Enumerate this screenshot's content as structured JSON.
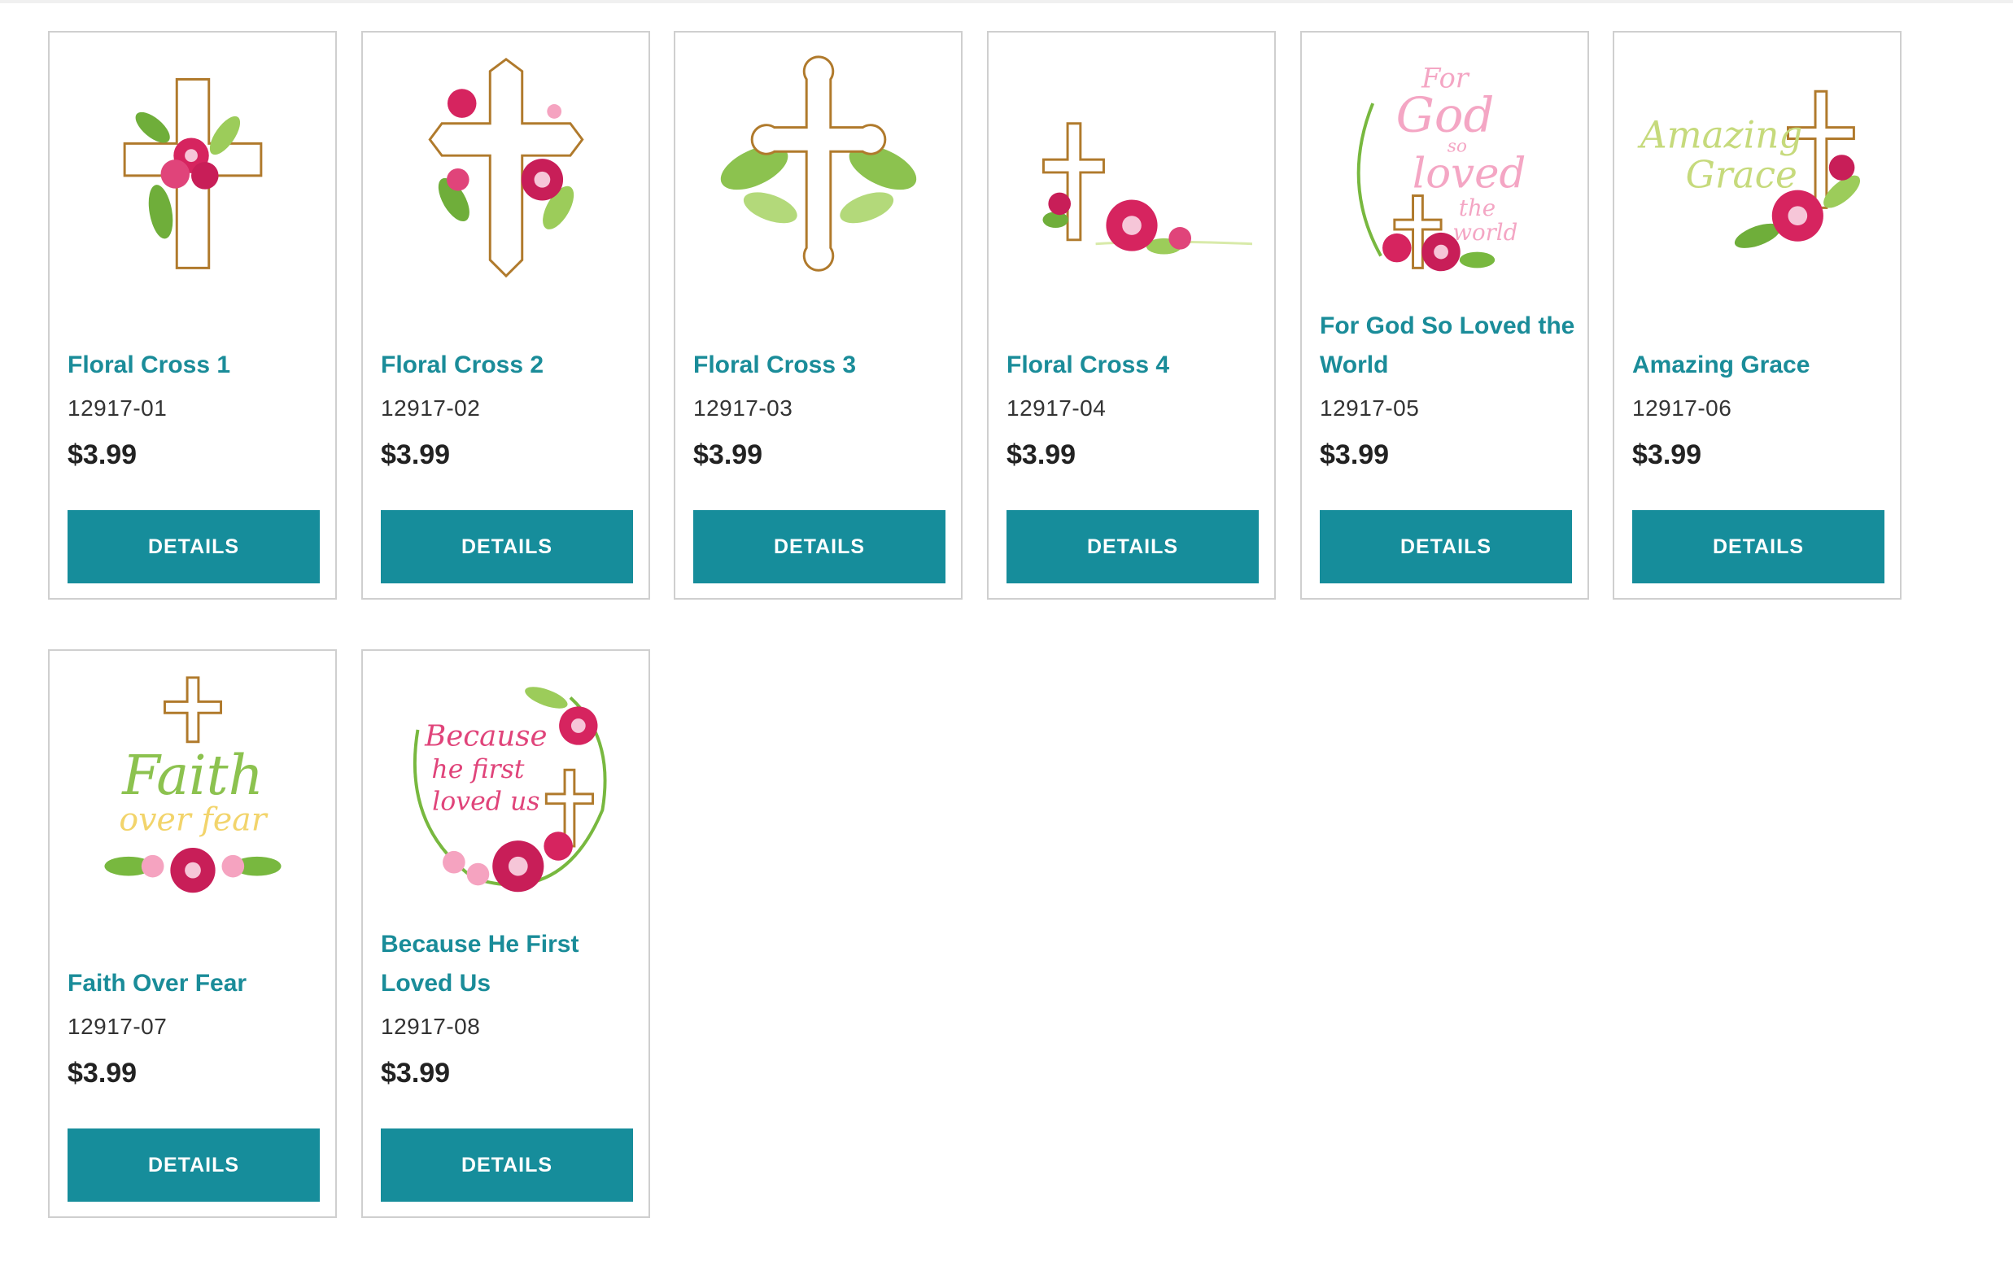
{
  "products": [
    {
      "title": "Floral Cross 1",
      "sku": "12917-01",
      "price": "$3.99",
      "button_label": "DETAILS",
      "icon": "floral-cross-icon"
    },
    {
      "title": "Floral Cross 2",
      "sku": "12917-02",
      "price": "$3.99",
      "button_label": "DETAILS",
      "icon": "floral-cross-icon"
    },
    {
      "title": "Floral Cross 3",
      "sku": "12917-03",
      "price": "$3.99",
      "button_label": "DETAILS",
      "icon": "floral-cross-icon"
    },
    {
      "title": "Floral Cross 4",
      "sku": "12917-04",
      "price": "$3.99",
      "button_label": "DETAILS",
      "icon": "floral-cross-icon"
    },
    {
      "title": "For God So Loved the World",
      "sku": "12917-05",
      "price": "$3.99",
      "button_label": "DETAILS",
      "icon": "script-cross-icon",
      "image_text": "For God so loved the world"
    },
    {
      "title": "Amazing Grace",
      "sku": "12917-06",
      "price": "$3.99",
      "button_label": "DETAILS",
      "icon": "script-cross-icon",
      "image_text": "Amazing Grace"
    },
    {
      "title": "Faith Over Fear",
      "sku": "12917-07",
      "price": "$3.99",
      "button_label": "DETAILS",
      "icon": "script-cross-icon",
      "image_text": "Faith over fear"
    },
    {
      "title": "Because He First Loved Us",
      "sku": "12917-08",
      "price": "$3.99",
      "button_label": "DETAILS",
      "icon": "script-cross-icon",
      "image_text": "Because he first loved us"
    }
  ],
  "colors": {
    "accent": "#168d9b",
    "title": "#1a8c99",
    "price": "#222222",
    "cross_outline": "#b07a2c",
    "rose": "#d6245f",
    "leaf": "#78b83f"
  }
}
